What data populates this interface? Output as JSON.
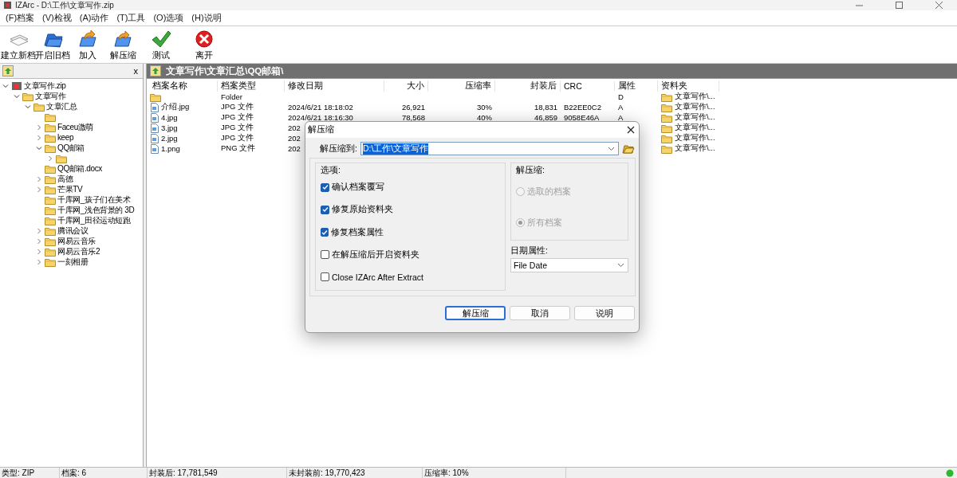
{
  "window": {
    "title": "IZArc - D:\\工作\\文章写作.zip"
  },
  "menu": [
    "(F)档案",
    "(V)检视",
    "(A)动作",
    "(T)工具",
    "(O)选项",
    "(H)说明"
  ],
  "toolbar": [
    {
      "label": "建立新档"
    },
    {
      "label": "开启旧档"
    },
    {
      "label": "加入"
    },
    {
      "label": "解压缩"
    },
    {
      "label": "测试"
    },
    {
      "label": "离开"
    }
  ],
  "tree_panel": {
    "close": "x",
    "items": [
      {
        "label": "文章写作.zip",
        "kind": "archive",
        "expanded": true,
        "children": [
          {
            "label": "文章写作",
            "kind": "folder",
            "expanded": true,
            "children": [
              {
                "label": "文章汇总",
                "kind": "folder",
                "expanded": true,
                "children": [
                  {
                    "kind": "folder"
                  },
                  {
                    "label": "Faceu激萌",
                    "kind": "folder",
                    "expanded": false
                  },
                  {
                    "label": "keep",
                    "kind": "folder",
                    "expanded": false
                  },
                  {
                    "label": "QQ邮箱",
                    "kind": "folder",
                    "expanded": true,
                    "children": [
                      {
                        "kind": "folder",
                        "expanded": false
                      }
                    ]
                  },
                  {
                    "label": "QQ邮箱.docx",
                    "kind": "folder"
                  },
                  {
                    "label": "高德",
                    "kind": "folder",
                    "expanded": false
                  },
                  {
                    "label": "芒果TV",
                    "kind": "folder",
                    "expanded": false
                  },
                  {
                    "label": "千库网_孩子们在美术",
                    "kind": "folder"
                  },
                  {
                    "label": "千库网_浅色背景的 3D",
                    "kind": "folder"
                  },
                  {
                    "label": "千库网_田径运动短跑",
                    "kind": "folder"
                  },
                  {
                    "label": "腾讯会议",
                    "kind": "folder",
                    "expanded": false
                  },
                  {
                    "label": "网易云音乐",
                    "kind": "folder",
                    "expanded": false
                  },
                  {
                    "label": "网易云音乐2",
                    "kind": "folder",
                    "expanded": false
                  },
                  {
                    "label": "一刻相册",
                    "kind": "folder",
                    "expanded": false
                  }
                ]
              }
            ]
          }
        ]
      }
    ]
  },
  "path_bar": {
    "path": "文章写作\\文章汇总\\QQ邮箱\\"
  },
  "file_list": {
    "columns": [
      "档案名称",
      "档案类型",
      "修改日期",
      "大小",
      "压缩率",
      "封装后",
      "CRC",
      "属性",
      "资料夹"
    ],
    "rows": [
      {
        "kind": "folder",
        "type": "Folder",
        "attributes": "D",
        "folder": "文章写作\\..."
      },
      {
        "kind": "file",
        "name": "介绍.jpg",
        "type": "JPG 文件",
        "modified": "2024/6/21 18:18:02",
        "size": "26,921",
        "ratio": "30%",
        "packed": "18,831",
        "crc": "B22EE0C2",
        "attributes": "A",
        "folder": "文章写作\\..."
      },
      {
        "kind": "file",
        "name": "4.jpg",
        "type": "JPG 文件",
        "modified": "2024/6/21 18:16:30",
        "size": "78,568",
        "ratio": "40%",
        "packed": "46,859",
        "crc": "9058E46A",
        "attributes": "A",
        "folder": "文章写作\\..."
      },
      {
        "kind": "file",
        "name": "3.jpg",
        "type": "JPG 文件",
        "modified": "202",
        "folder": "文章写作\\..."
      },
      {
        "kind": "file",
        "name": "2.jpg",
        "type": "JPG 文件",
        "modified": "202",
        "folder": "文章写作\\..."
      },
      {
        "kind": "file",
        "name": "1.png",
        "type": "PNG 文件",
        "modified": "202",
        "folder": "文章写作\\..."
      }
    ]
  },
  "extract_dialog": {
    "title": "解压缩",
    "target_label": "解压缩到:",
    "target_value": "D:\\工作\\文章写作",
    "options_title": "选项:",
    "options": [
      {
        "label": "确认档案覆写",
        "checked": true
      },
      {
        "label": "修复原始资料夹",
        "checked": true
      },
      {
        "label": "修复档案属性",
        "checked": true
      },
      {
        "label": "在解压缩后开启资料夹",
        "checked": false
      },
      {
        "label": "Close IZArc After Extract",
        "checked": false
      }
    ],
    "extract_title": "解压缩:",
    "extract_choices": [
      {
        "label": "选取的档案",
        "selected": false,
        "disabled": true
      },
      {
        "label": "所有档案",
        "selected": true,
        "disabled": true
      }
    ],
    "date_label": "日期属性:",
    "date_value": "File Date",
    "buttons": [
      {
        "label": "解压缩",
        "default": true
      },
      {
        "label": "取消",
        "default": false
      },
      {
        "label": "说明",
        "default": false
      }
    ]
  },
  "status_bar": [
    "类型: ZIP",
    "档案: 6",
    "封装后: 17,781,549",
    "未封装前: 19,770,423",
    "压缩率: 10%"
  ]
}
